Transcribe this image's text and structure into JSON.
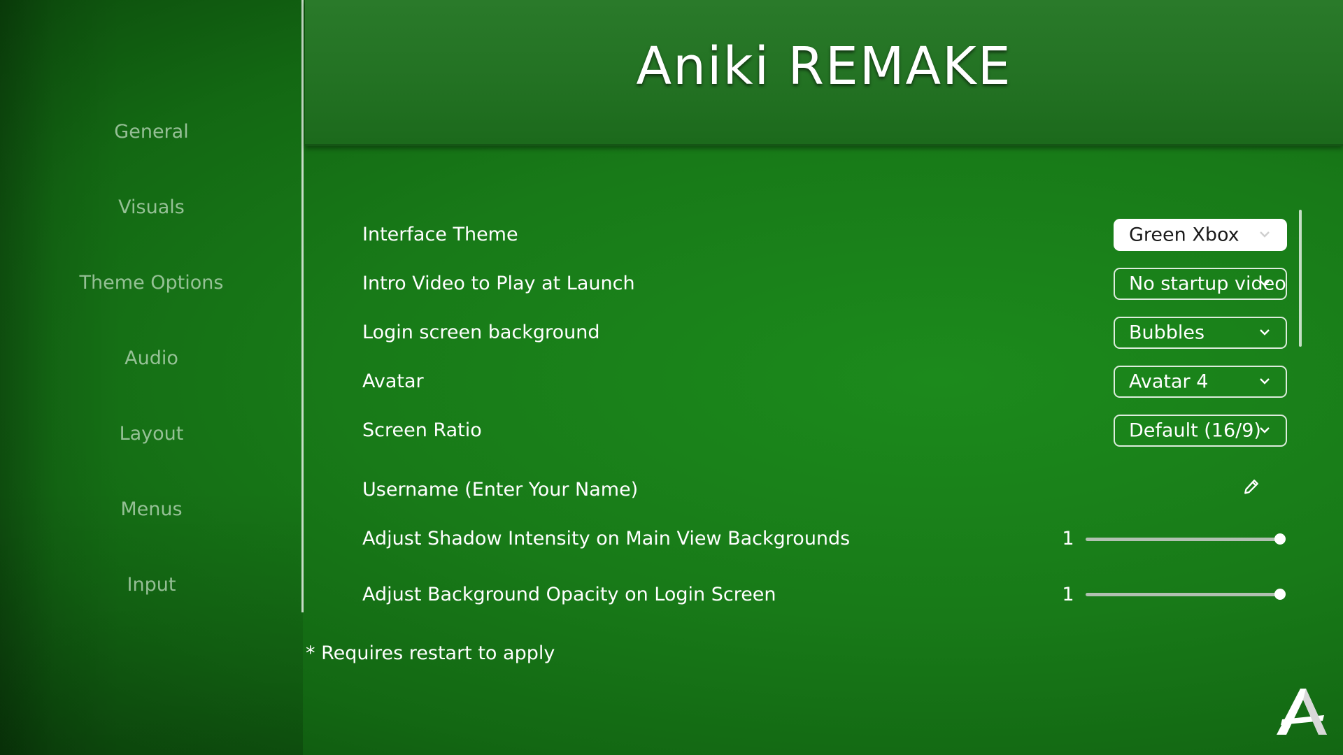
{
  "app": {
    "title": "Aniki REMAKE"
  },
  "sidebar": {
    "items": [
      {
        "label": "General"
      },
      {
        "label": "Visuals"
      },
      {
        "label": "Theme Options"
      },
      {
        "label": "Audio"
      },
      {
        "label": "Layout"
      },
      {
        "label": "Menus"
      },
      {
        "label": "Input"
      }
    ]
  },
  "settings": {
    "interface_theme": {
      "label": "Interface Theme",
      "value": "Green Xbox"
    },
    "intro_video": {
      "label": "Intro Video to Play at Launch",
      "value": "No startup video"
    },
    "login_background": {
      "label": "Login screen background",
      "value": "Bubbles"
    },
    "avatar": {
      "label": "Avatar",
      "value": "Avatar 4"
    },
    "screen_ratio": {
      "label": "Screen Ratio",
      "value": "Default (16/9)"
    },
    "username": {
      "label": "Username (Enter Your Name)",
      "icon": "pencil-icon"
    },
    "shadow_intensity": {
      "label": "Adjust Shadow Intensity on Main View Backgrounds",
      "value": "1",
      "fraction": 1.0
    },
    "background_opacity": {
      "label": "Adjust Background Opacity on Login Screen",
      "value": "1",
      "fraction": 1.0
    }
  },
  "footnote": "* Requires restart to apply",
  "icons": {
    "logo": "aniki-logo-icon",
    "chevron": "chevron-down-icon"
  },
  "colors": {
    "background": "#187a18",
    "header": "#237223",
    "accent": "#ffffff"
  }
}
